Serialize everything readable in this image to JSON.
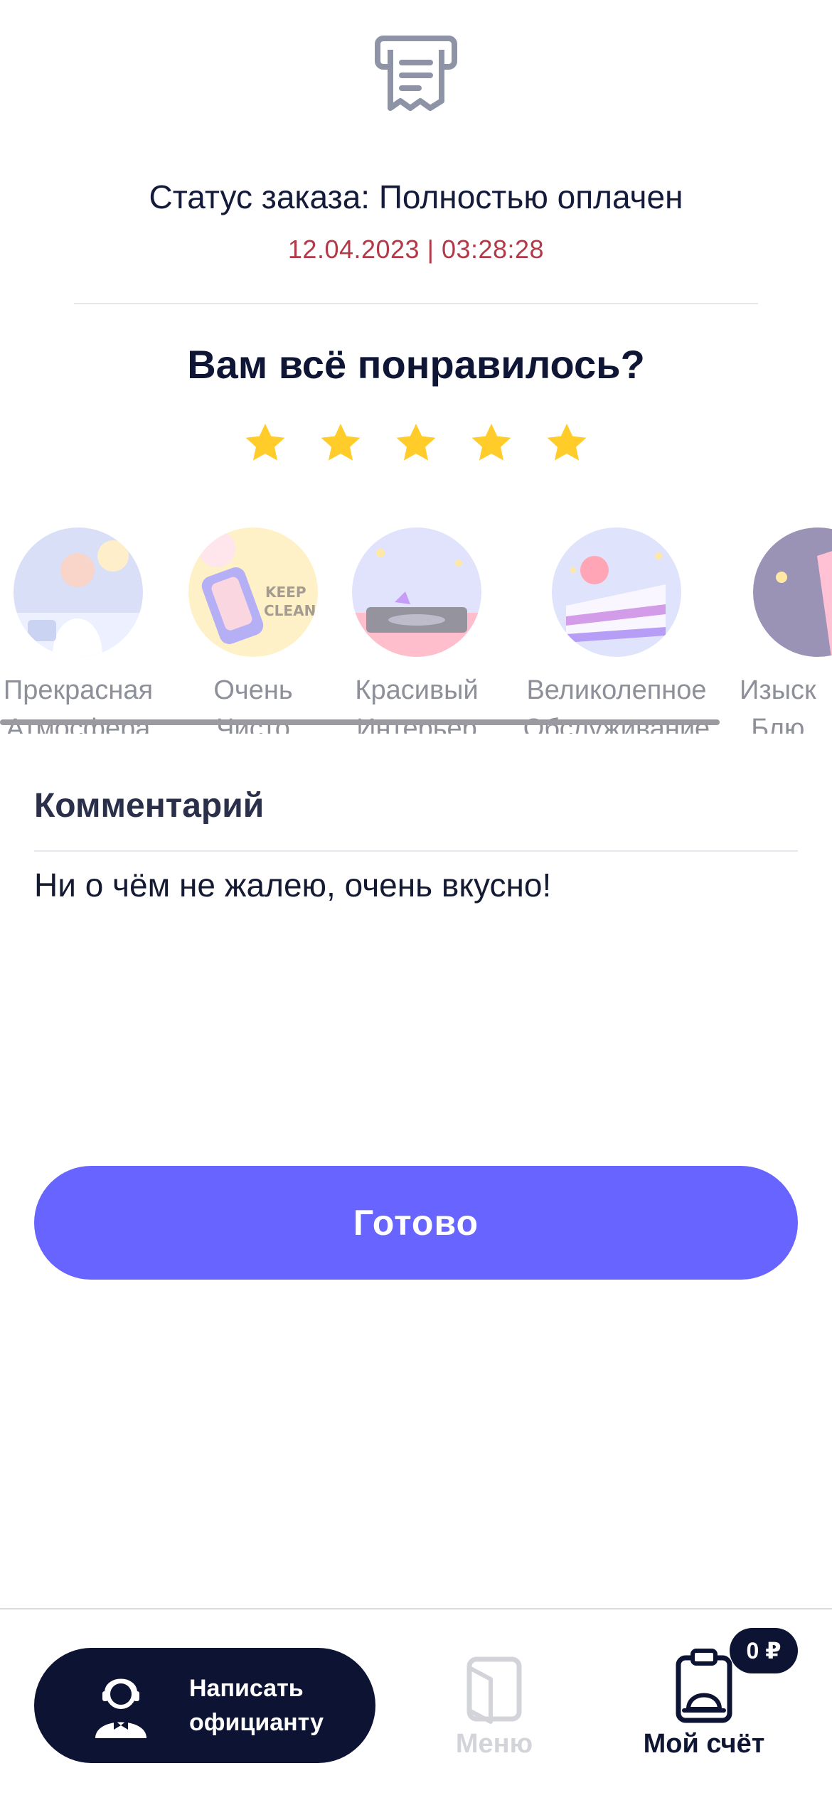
{
  "order": {
    "status_text": "Статус заказа: Полностью оплачен",
    "datetime": "12.04.2023 | 03:28:28"
  },
  "rating": {
    "question": "Вам всё понравилось?",
    "stars_selected": 5,
    "stars_total": 5
  },
  "categories": [
    {
      "label": "Прекрасная\nАтмосфера",
      "icon": "atmosphere-illustration"
    },
    {
      "label": "Очень\nЧисто",
      "icon": "keep-clean-illustration"
    },
    {
      "label": "Красивый\nИнтерьер",
      "icon": "interior-illustration"
    },
    {
      "label": "Великолепное\nОбслуживание",
      "icon": "cake-illustration"
    },
    {
      "label": "Изыск\nБлю",
      "icon": "dish-illustration"
    }
  ],
  "comment": {
    "title": "Комментарий",
    "text": "Ни о чём не жалею, очень вкусно!"
  },
  "actions": {
    "done_label": "Готово"
  },
  "bottom_nav": {
    "waiter_label": "Написать\nофицианту",
    "menu_label": "Меню",
    "bill_label": "Мой счёт",
    "bill_badge": "0 ₽"
  },
  "colors": {
    "accent": "#6864ff",
    "dark": "#0d1333",
    "star": "#ffcc29",
    "muted": "#8d8f99"
  }
}
